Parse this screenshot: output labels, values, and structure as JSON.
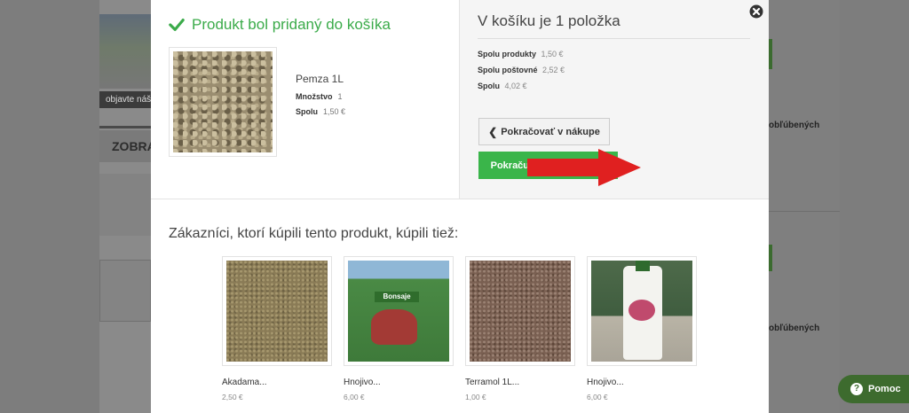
{
  "background": {
    "caption": "objavte náš",
    "zobraz": "ZOBRAZ",
    "right_text_1": "obľúbených",
    "right_text_2": "obľúbených"
  },
  "added": {
    "title": "Produkt bol pridaný do košíka",
    "product_name": "Pemza 1L",
    "quantity_label": "Množstvo",
    "quantity_value": "1",
    "total_label": "Spolu",
    "total_value": "1,50 €"
  },
  "cart": {
    "title": "V košíku je 1 položka",
    "products_label": "Spolu produkty",
    "products_value": "1,50 €",
    "shipping_label": "Spolu poštovné",
    "shipping_value": "2,52 €",
    "total_label": "Spolu",
    "total_value": "4,02 €",
    "continue_label": "Pokračovať v nákupe",
    "checkout_label": "Pokračujte k pokladni"
  },
  "also_bought": {
    "title": "Zákazníci, ktorí kúpili tento produkt, kúpili tiež:",
    "items": [
      {
        "name": "Akadama...",
        "price": "2,50 €"
      },
      {
        "name": "Hnojivo...",
        "price": "6,00 €"
      },
      {
        "name": "Terramol 1L...",
        "price": "1,00 €"
      },
      {
        "name": "Hnojivo...",
        "price": "6,00 €"
      }
    ],
    "fert_label": "Bonsaje"
  },
  "help": {
    "label": "Pomoc"
  },
  "colors": {
    "accent_green": "#3ab54a",
    "arrow_red": "#e02020",
    "help_green": "#3d6b2e"
  }
}
